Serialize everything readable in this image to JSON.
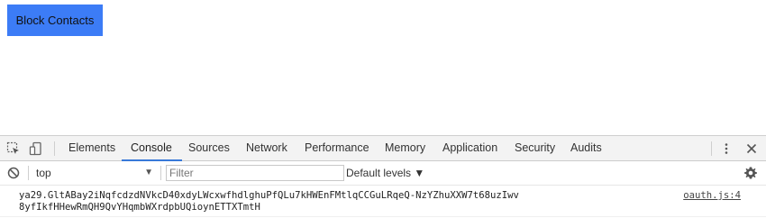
{
  "page": {
    "block_button_label": "Block Contacts"
  },
  "devtools": {
    "toolbar_icons": [
      "inspect-element-icon",
      "device-toolbar-icon"
    ],
    "tabs": [
      {
        "label": "Elements",
        "active": false
      },
      {
        "label": "Console",
        "active": true
      },
      {
        "label": "Sources",
        "active": false
      },
      {
        "label": "Network",
        "active": false
      },
      {
        "label": "Performance",
        "active": false
      },
      {
        "label": "Memory",
        "active": false
      },
      {
        "label": "Application",
        "active": false
      },
      {
        "label": "Security",
        "active": false
      },
      {
        "label": "Audits",
        "active": false
      }
    ],
    "more_icon": "kebab-menu-icon",
    "close_icon": "close-icon"
  },
  "console": {
    "clear_icon": "clear-console-icon",
    "context": "top",
    "filter_placeholder": "Filter",
    "filter_value": "",
    "levels_label": "Default levels ▼",
    "settings_icon": "gear-icon",
    "messages": [
      {
        "text": "ya29.GltABay2iNqfcdzdNVkcD40xdyLWcxwfhdlghuPfQLu7kHWEnFMtlqCCGuLRqeQ-NzYZhuXXW7t68uzIwv8yfIkfHHewRmQH9QvYHqmbWXrdpbUQioynETTXTmtH",
        "source": "oauth.js:4"
      }
    ]
  },
  "colors": {
    "button_bg": "#3c7cf6",
    "active_tab_underline": "#3879d9",
    "devtools_toolbar_bg": "#f3f3f3"
  }
}
